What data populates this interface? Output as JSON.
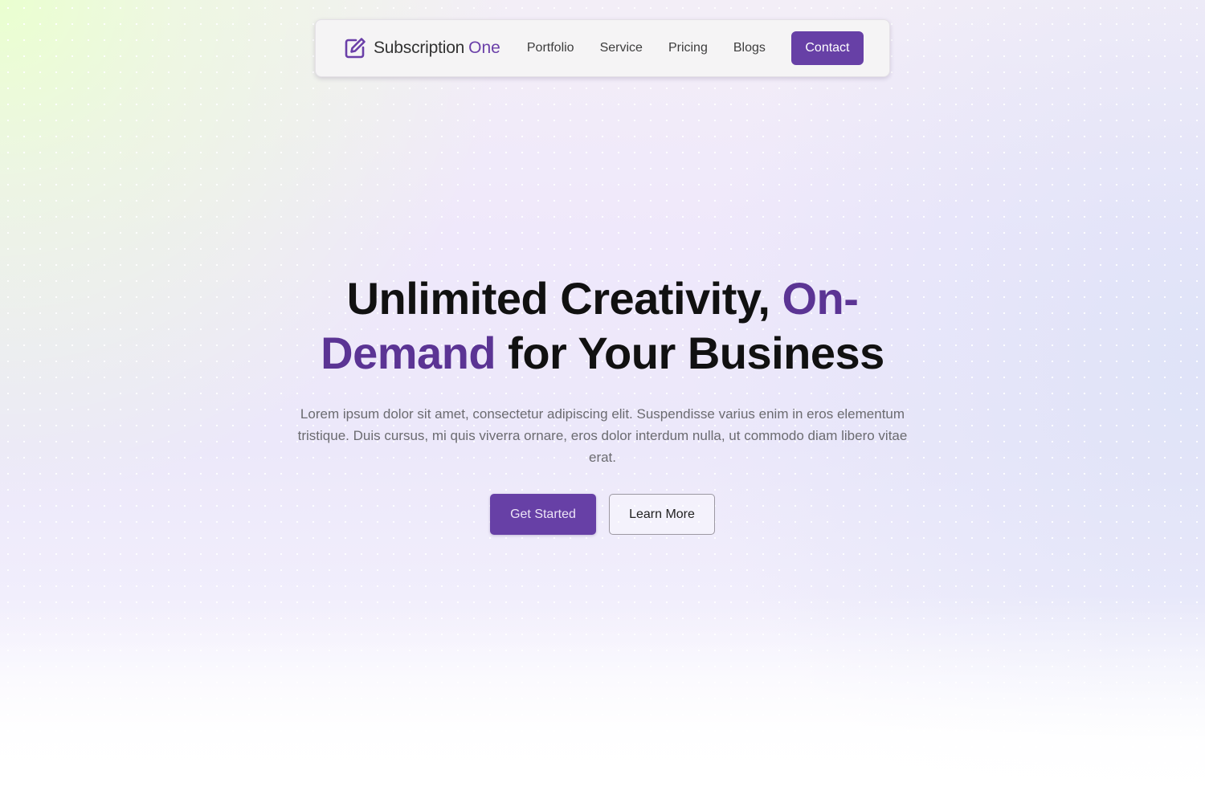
{
  "navbar": {
    "brand": {
      "name": "Subscription",
      "accent": "One",
      "icon": "edit-icon"
    },
    "links": [
      "Portfolio",
      "Service",
      "Pricing",
      "Blogs"
    ],
    "contact_label": "Contact"
  },
  "hero": {
    "title_part1": "Unlimited Creativity, ",
    "title_accent": "On-Demand",
    "title_part2": " for Your Business",
    "description": "Lorem ipsum dolor sit amet, consectetur adipiscing elit. Suspendisse varius enim in eros elementum tristique. Duis cursus, mi quis viverra ornare, eros dolor interdum nulla, ut commodo diam libero vitae erat.",
    "primary_label": "Get Started",
    "secondary_label": "Learn More"
  },
  "colors": {
    "accent": "#6740a6",
    "accent_text": "#5b3494",
    "heading": "#111111",
    "body_text": "#6b6b70"
  }
}
